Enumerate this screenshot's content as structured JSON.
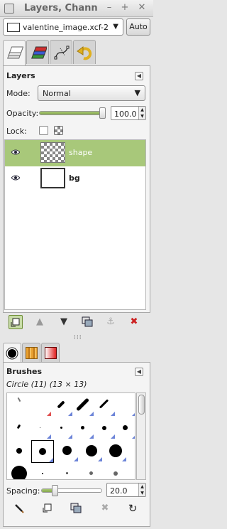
{
  "window": {
    "title": "Layers, Chann"
  },
  "image_selector": {
    "value": "valentine_image.xcf-2",
    "auto_label": "Auto"
  },
  "tabs": [
    {
      "name": "layers",
      "icon": "layers-icon"
    },
    {
      "name": "channels",
      "icon": "channels-icon"
    },
    {
      "name": "paths",
      "icon": "paths-icon"
    },
    {
      "name": "undo-history",
      "icon": "undo-history-icon"
    }
  ],
  "layers_panel": {
    "title": "Layers",
    "mode_label": "Mode:",
    "mode_value": "Normal",
    "opacity_label": "Opacity:",
    "opacity_value": "100.0",
    "opacity_fraction": 1.0,
    "lock_label": "Lock:",
    "layers": [
      {
        "name": "shape",
        "visible": true,
        "selected": true,
        "thumb": "checker"
      },
      {
        "name": "bg",
        "visible": true,
        "selected": false,
        "thumb": "white"
      }
    ]
  },
  "layer_buttons": [
    "new-layer-icon",
    "raise-layer-icon",
    "lower-layer-icon",
    "duplicate-layer-icon",
    "anchor-layer-icon",
    "delete-layer-icon"
  ],
  "dock_tabs": [
    {
      "name": "brushes",
      "icon": "brush-circle-icon"
    },
    {
      "name": "patterns",
      "icon": "pattern-icon"
    },
    {
      "name": "gradients",
      "icon": "gradient-icon"
    }
  ],
  "brushes_panel": {
    "title": "Brushes",
    "selected_brush": "Circle (11) (13 × 13)",
    "spacing_label": "Spacing:",
    "spacing_value": "20.0",
    "spacing_fraction": 0.2
  },
  "brush_buttons": [
    "edit-brush-icon",
    "new-brush-icon",
    "duplicate-brush-icon",
    "delete-brush-icon",
    "refresh-brushes-icon"
  ],
  "colors": {
    "selected_row": "#a8c87a",
    "slider_fill": "#8fb05a",
    "delete_red": "#cc2020"
  }
}
